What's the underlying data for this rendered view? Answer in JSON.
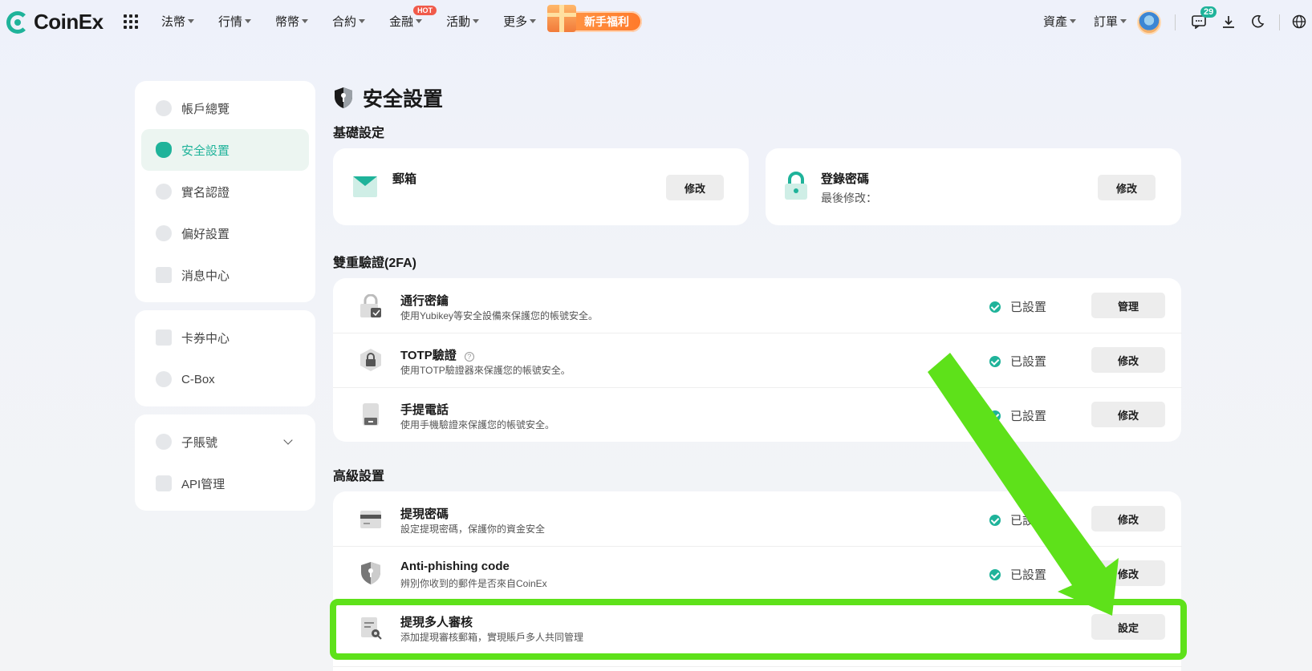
{
  "nav": {
    "brand": "CoinEx",
    "menu": [
      {
        "label": "法幣"
      },
      {
        "label": "行情"
      },
      {
        "label": "幣幣"
      },
      {
        "label": "合約"
      },
      {
        "label": "金融",
        "badge": "HOT"
      },
      {
        "label": "活動"
      },
      {
        "label": "更多"
      }
    ],
    "promo": "新手福利",
    "right": [
      {
        "label": "資產"
      },
      {
        "label": "訂單"
      }
    ],
    "message_count": "29"
  },
  "sidebar": {
    "groups": [
      [
        {
          "label": "帳戶總覽",
          "icon": "pie-chart-icon"
        },
        {
          "label": "安全設置",
          "icon": "shield-icon",
          "active": true
        },
        {
          "label": "實名認證",
          "icon": "id-card-icon"
        },
        {
          "label": "偏好設置",
          "icon": "settings-icon"
        },
        {
          "label": "消息中心",
          "icon": "message-icon"
        }
      ],
      [
        {
          "label": "卡券中心",
          "icon": "coupon-icon"
        },
        {
          "label": "C-Box",
          "icon": "box-icon"
        }
      ],
      [
        {
          "label": "子賬號",
          "icon": "sub-account-icon"
        },
        {
          "label": "API管理",
          "icon": "api-icon"
        }
      ]
    ]
  },
  "page_title": "安全設置",
  "basic": {
    "title": "基礎設定",
    "email": {
      "label": "郵箱",
      "button": "修改"
    },
    "password": {
      "label": "登錄密碼",
      "sub": "最後修改：",
      "button": "修改"
    }
  },
  "twofa": {
    "title": "雙重驗證(2FA)",
    "rows": [
      {
        "title": "通行密鑰",
        "desc": "使用Yubikey等安全設備來保護您的帳號安全。",
        "status": "已設置",
        "button": "管理"
      },
      {
        "title": "TOTP驗證",
        "desc": "使用TOTP驗證器來保護您的帳號安全。",
        "status": "已設置",
        "button": "修改"
      },
      {
        "title": "手提電話",
        "desc": "使用手機驗證來保護您的帳號安全。",
        "status": "已設置",
        "button": "修改"
      }
    ]
  },
  "advanced": {
    "title": "高級設置",
    "rows": [
      {
        "title": "提現密碼",
        "desc": "設定提現密碼，保護你的資金安全",
        "status": "已設置",
        "button": "修改"
      },
      {
        "title": "Anti-phishing code",
        "desc": "辨別你收到的郵件是否來自CoinEx",
        "status": "已設置",
        "button": "修改"
      },
      {
        "title": "提現多人審核",
        "desc": "添加提現審核郵箱，實現賬戶多人共同管理",
        "button": "設定"
      }
    ]
  },
  "colors": {
    "accent": "#1fb39a",
    "annotation": "#5ee11a"
  }
}
